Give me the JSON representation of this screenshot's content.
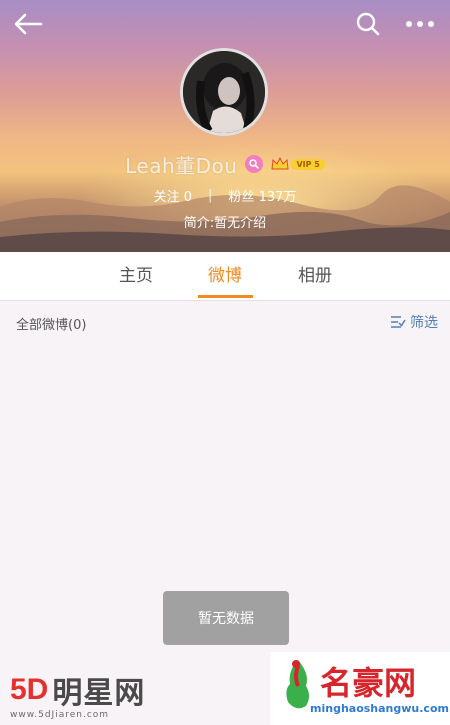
{
  "header": {
    "back_icon": "back-arrow-icon",
    "search_icon": "search-icon",
    "more_icon": "more-dots-icon"
  },
  "profile": {
    "name": "Leah董Dou",
    "gender_icon": "female-gender-icon",
    "vip_label": "VIP 5",
    "following_label": "关注",
    "following_count": "0",
    "followers_label": "粉丝",
    "followers_count": "137万",
    "bio": "简介:暂无介绍"
  },
  "tabs": [
    {
      "label": "主页",
      "active": false
    },
    {
      "label": "微博",
      "active": true
    },
    {
      "label": "相册",
      "active": false
    }
  ],
  "filter": {
    "all_posts": "全部微博(0)",
    "filter_label": "筛选"
  },
  "empty_state": "暂无数据",
  "watermark_left": {
    "brand_5d": "5D",
    "brand_cn": "明星网",
    "url": "www.5dJiaren.com"
  },
  "watermark_right": {
    "title": "名豪网",
    "url": "minghaoshangwu.com"
  },
  "colors": {
    "accent": "#f08a22",
    "filter_blue": "#4f7fb9",
    "toast_bg": "#a1a1a1"
  }
}
